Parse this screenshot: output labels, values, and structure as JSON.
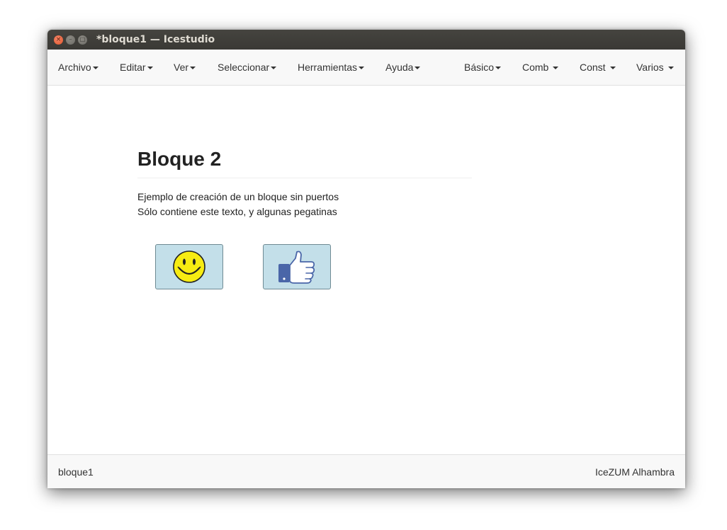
{
  "window": {
    "title": "*bloque1 — Icestudio",
    "buttons": {
      "close": "×",
      "minimize": "–",
      "maximize": "□"
    }
  },
  "menubar": {
    "left": [
      {
        "label": "Archivo"
      },
      {
        "label": "Editar"
      },
      {
        "label": "Ver"
      },
      {
        "label": "Seleccionar"
      },
      {
        "label": "Herramientas"
      },
      {
        "label": "Ayuda"
      }
    ],
    "right": [
      {
        "label": "Básico"
      },
      {
        "label": "Comb"
      },
      {
        "label": "Const"
      },
      {
        "label": "Varios"
      }
    ]
  },
  "content": {
    "heading": "Bloque 2",
    "line1": "Ejemplo de creación de un bloque sin puertos",
    "line2": "Sólo contiene este texto, y algunas pegatinas",
    "stickers": [
      {
        "icon": "smiley-face-icon"
      },
      {
        "icon": "thumbs-up-icon"
      }
    ]
  },
  "footer": {
    "file": "bloque1",
    "board": "IceZUM Alhambra"
  },
  "colors": {
    "sticker_bg": "#c3dfe9",
    "smiley": "#f7ec12",
    "thumb": "#4a66a8"
  }
}
